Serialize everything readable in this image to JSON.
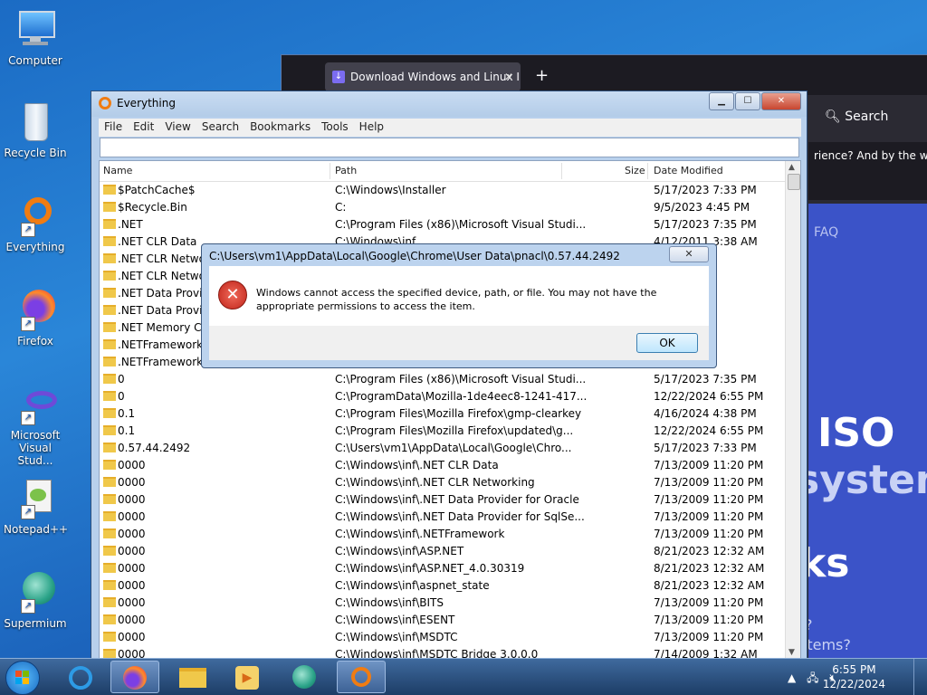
{
  "desktop": {
    "icons": [
      {
        "label": "Computer"
      },
      {
        "label": "Recycle Bin"
      },
      {
        "label": "Everything"
      },
      {
        "label": "Firefox"
      },
      {
        "label": "Microsoft Visual Stud..."
      },
      {
        "label": "Notepad++"
      },
      {
        "label": "Supermium"
      }
    ]
  },
  "browser": {
    "tab_title": "Download Windows and Linux I",
    "new_tab": "+",
    "search_label": "Search",
    "promo_text": "rience? And by the way, w",
    "page_faq": "FAQ",
    "page_big1": "ISO",
    "page_big2": "system",
    "page_big3": "ks",
    "page_small1": "?",
    "page_small2": "stems?"
  },
  "everything": {
    "title": "Everything",
    "menu": [
      "File",
      "Edit",
      "View",
      "Search",
      "Bookmarks",
      "Tools",
      "Help"
    ],
    "search_value": "",
    "columns": {
      "name": "Name",
      "path": "Path",
      "size": "Size",
      "date": "Date Modified"
    },
    "rows": [
      {
        "name": "$PatchCache$",
        "path": "C:\\Windows\\Installer",
        "date": "5/17/2023 7:33 PM"
      },
      {
        "name": "$Recycle.Bin",
        "path": "C:",
        "date": "9/5/2023 4:45 PM"
      },
      {
        "name": ".NET",
        "path": "C:\\Program Files (x86)\\Microsoft Visual Studi...",
        "date": "5/17/2023 7:35 PM"
      },
      {
        "name": ".NET CLR Data",
        "path": "C:\\Windows\\inf",
        "date": "4/12/2011 3:38 AM"
      },
      {
        "name": ".NET CLR Networ",
        "path": "",
        "date": "3 AM"
      },
      {
        "name": ".NET CLR Networ",
        "path": "",
        "date": "3 AM"
      },
      {
        "name": ".NET Data Provide",
        "path": "",
        "date": "3 AM"
      },
      {
        "name": ".NET Data Provide",
        "path": "",
        "date": "3 AM"
      },
      {
        "name": ".NET Memory Cac",
        "path": "",
        "date": "3 AM"
      },
      {
        "name": ".NETFramework",
        "path": "",
        "date": "3 AM"
      },
      {
        "name": ".NETFramework",
        "path": "",
        "date": "3 AM"
      },
      {
        "name": "0",
        "path": "C:\\Program Files (x86)\\Microsoft Visual Studi...",
        "date": "5/17/2023 7:35 PM"
      },
      {
        "name": "0",
        "path": "C:\\ProgramData\\Mozilla-1de4eec8-1241-417...",
        "date": "12/22/2024 6:55 PM"
      },
      {
        "name": "0.1",
        "path": "C:\\Program Files\\Mozilla Firefox\\gmp-clearkey",
        "date": "4/16/2024 4:38 PM"
      },
      {
        "name": "0.1",
        "path": "C:\\Program Files\\Mozilla Firefox\\updated\\g...",
        "date": "12/22/2024 6:55 PM"
      },
      {
        "name": "0.57.44.2492",
        "path": "C:\\Users\\vm1\\AppData\\Local\\Google\\Chro...",
        "date": "5/17/2023 7:33 PM"
      },
      {
        "name": "0000",
        "path": "C:\\Windows\\inf\\.NET CLR Data",
        "date": "7/13/2009 11:20 PM"
      },
      {
        "name": "0000",
        "path": "C:\\Windows\\inf\\.NET CLR Networking",
        "date": "7/13/2009 11:20 PM"
      },
      {
        "name": "0000",
        "path": "C:\\Windows\\inf\\.NET Data Provider for Oracle",
        "date": "7/13/2009 11:20 PM"
      },
      {
        "name": "0000",
        "path": "C:\\Windows\\inf\\.NET Data Provider for SqlSe...",
        "date": "7/13/2009 11:20 PM"
      },
      {
        "name": "0000",
        "path": "C:\\Windows\\inf\\.NETFramework",
        "date": "7/13/2009 11:20 PM"
      },
      {
        "name": "0000",
        "path": "C:\\Windows\\inf\\ASP.NET",
        "date": "8/21/2023 12:32 AM"
      },
      {
        "name": "0000",
        "path": "C:\\Windows\\inf\\ASP.NET_4.0.30319",
        "date": "8/21/2023 12:32 AM"
      },
      {
        "name": "0000",
        "path": "C:\\Windows\\inf\\aspnet_state",
        "date": "8/21/2023 12:32 AM"
      },
      {
        "name": "0000",
        "path": "C:\\Windows\\inf\\BITS",
        "date": "7/13/2009 11:20 PM"
      },
      {
        "name": "0000",
        "path": "C:\\Windows\\inf\\ESENT",
        "date": "7/13/2009 11:20 PM"
      },
      {
        "name": "0000",
        "path": "C:\\Windows\\inf\\MSDTC",
        "date": "7/13/2009 11:20 PM"
      },
      {
        "name": "0000",
        "path": "C:\\Windows\\inf\\MSDTC Bridge 3.0.0.0",
        "date": "7/14/2009 1:32 AM"
      }
    ]
  },
  "dialog": {
    "title": "C:\\Users\\vm1\\AppData\\Local\\Google\\Chrome\\User Data\\pnacl\\0.57.44.2492",
    "message": "Windows cannot access the specified device, path, or file.  You may not have the appropriate permissions to access the item.",
    "ok_label": "OK",
    "close_label": "✕"
  },
  "taskbar": {
    "time": "6:55 PM",
    "date": "12/22/2024"
  }
}
